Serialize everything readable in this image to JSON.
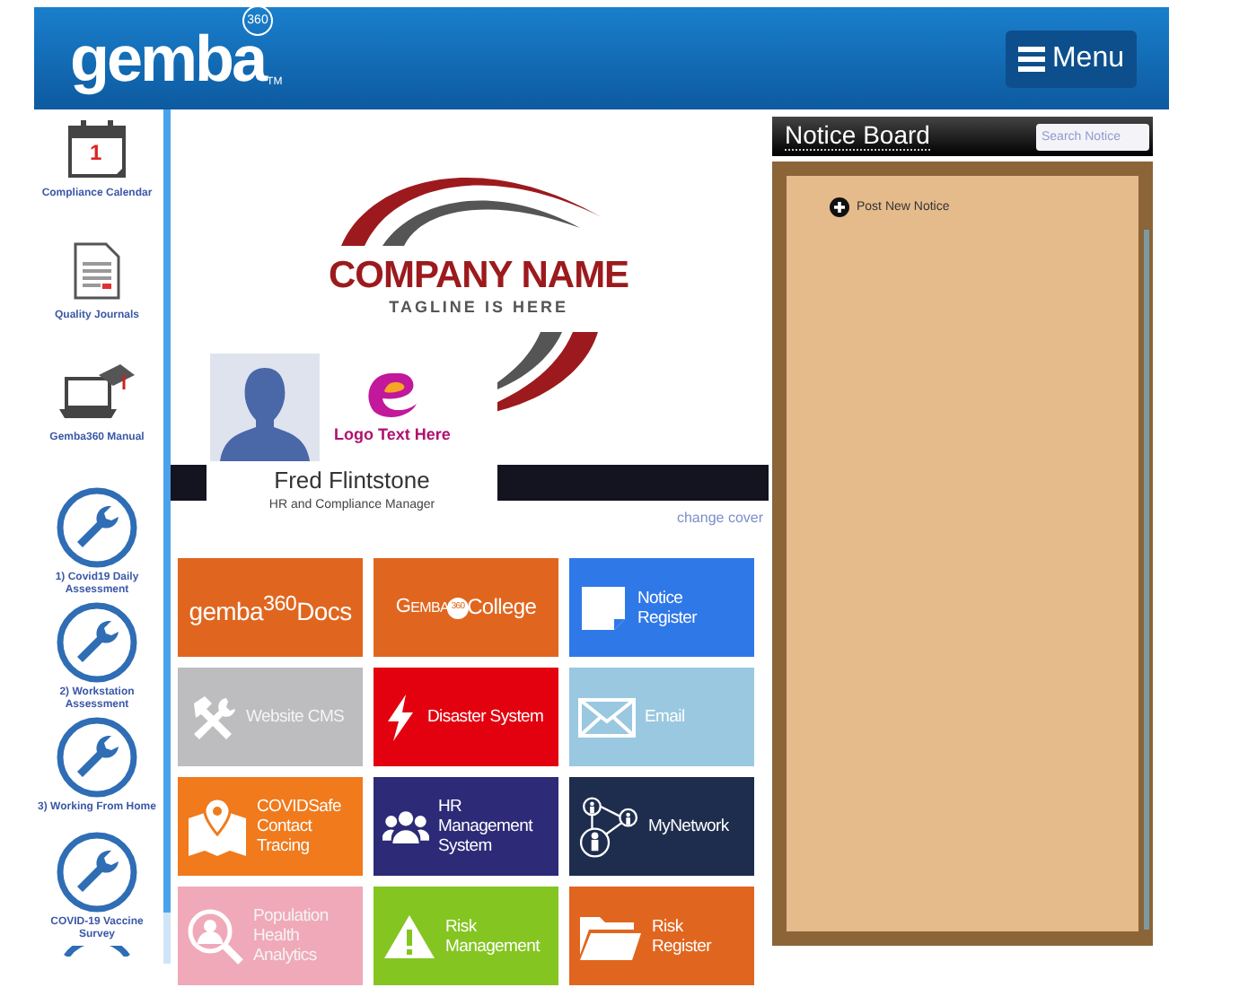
{
  "header": {
    "logo": "gemba",
    "logo_badge": "360",
    "logo_tm": "TM",
    "menu_button": "Menu"
  },
  "sidebar": {
    "items": [
      {
        "kind": "calendar",
        "label": "Compliance Calendar",
        "icon_text": "1"
      },
      {
        "kind": "journal",
        "label": "Quality Journals"
      },
      {
        "kind": "laptop",
        "label": "Gemba360 Manual"
      },
      {
        "kind": "wrench",
        "label": "1) Covid19 Daily Assessment"
      },
      {
        "kind": "wrench",
        "label": "2) Workstation Assessment"
      },
      {
        "kind": "wrench",
        "label": "3) Working From Home"
      },
      {
        "kind": "wrench",
        "label": "COVID-19 Vaccine Survey"
      },
      {
        "kind": "wrench_partial"
      }
    ]
  },
  "cover": {
    "company_name": "COMPANY NAME",
    "tagline": "TAGLINE IS HERE",
    "change_link": "change cover"
  },
  "profile": {
    "company_logo_text": "Logo Text Here",
    "name": "Fred Flintstone",
    "role": "HR and Compliance Manager"
  },
  "tiles": [
    {
      "kind": "docs",
      "label": "gemba$^{360}$Docs",
      "color": "#e0661f"
    },
    {
      "kind": "college",
      "label": "Gemba",
      "badge": "360",
      "label_2": "College",
      "color": "#e0661f"
    },
    {
      "kind": "notice",
      "label": "Notice Register",
      "color": "#2f78e8"
    },
    {
      "kind": "tools",
      "label": "Website CMS",
      "color": "#bdbdbf"
    },
    {
      "kind": "bolt",
      "label": "Disaster System",
      "color": "#e3000f"
    },
    {
      "kind": "mail",
      "label": "Email",
      "color": "#9ac8e0"
    },
    {
      "kind": "map",
      "label": "COVIDSafe Contact Tracing",
      "color": "#f07a1c"
    },
    {
      "kind": "people",
      "label": "HR Management System",
      "color": "#2d2a78"
    },
    {
      "kind": "network",
      "label": "MyNetwork",
      "color": "#1e2d4e"
    },
    {
      "kind": "search",
      "label": "Population Health Analytics",
      "color": "#f0a9b8"
    },
    {
      "kind": "warning",
      "label": "Risk Management",
      "color": "#84c521"
    },
    {
      "kind": "folder",
      "label": "Risk Register",
      "color": "#e0661f"
    }
  ],
  "notice_board": {
    "title": "Notice Board",
    "search": {
      "placeholder": "Search Notice"
    },
    "post_button": "Post New Notice"
  }
}
